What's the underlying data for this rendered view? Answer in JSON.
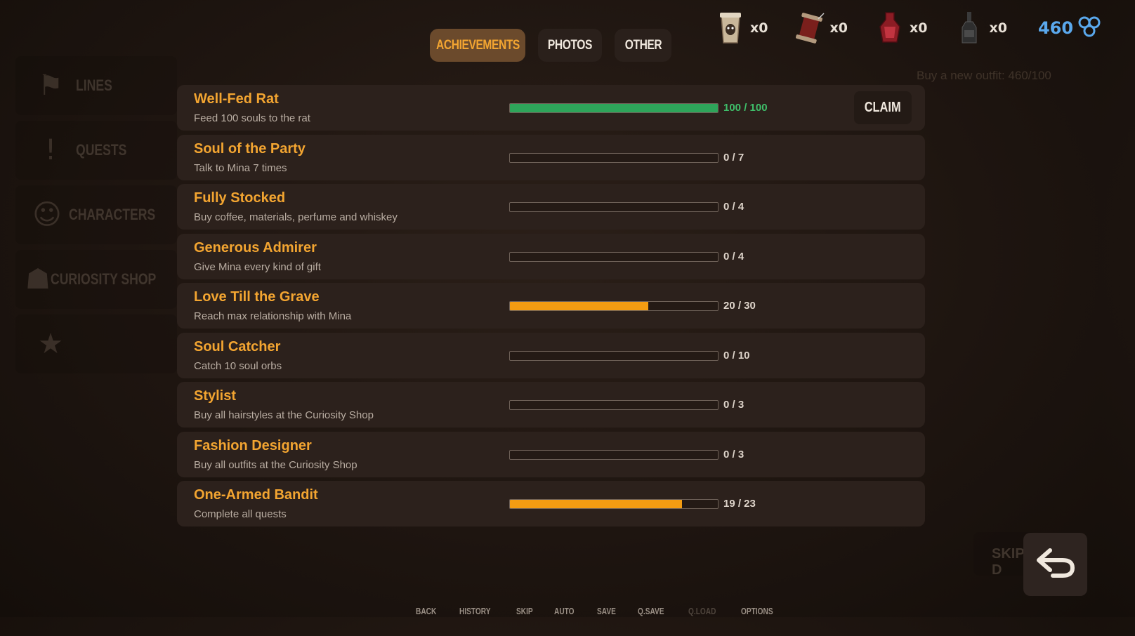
{
  "tabs": [
    {
      "label": "ACHIEVEMENTS",
      "active": true
    },
    {
      "label": "PHOTOS",
      "active": false
    },
    {
      "label": "OTHER",
      "active": false
    }
  ],
  "currency": {
    "items": [
      {
        "icon": "coffee-cup-icon",
        "count": "x0"
      },
      {
        "icon": "thread-spool-icon",
        "count": "x0"
      },
      {
        "icon": "perfume-bottle-icon",
        "count": "x0"
      },
      {
        "icon": "whiskey-bottle-icon",
        "count": "x0"
      }
    ],
    "souls": "460",
    "souls_icon": "soul-orb-icon",
    "souls_color": "#5aa8ec"
  },
  "background": {
    "menu": [
      "LINES",
      "QUESTS",
      "CHARACTERS",
      "CURIOSITY SHOP"
    ],
    "outfit_text": "Buy a new outfit:  460/100",
    "skip_text": "SKIP D"
  },
  "achievements": [
    {
      "title": "Well-Fed Rat",
      "desc": "Feed 100 souls to the rat",
      "current": 100,
      "total": 100,
      "progress_text": "100 / 100",
      "completed": true,
      "claim_label": "CLAIM"
    },
    {
      "title": "Soul of the Party",
      "desc": "Talk to Mina 7 times",
      "current": 0,
      "total": 7,
      "progress_text": "0 / 7",
      "completed": false
    },
    {
      "title": "Fully Stocked",
      "desc": "Buy coffee, materials, perfume and whiskey",
      "current": 0,
      "total": 4,
      "progress_text": "0 / 4",
      "completed": false
    },
    {
      "title": "Generous Admirer",
      "desc": "Give Mina every kind of gift",
      "current": 0,
      "total": 4,
      "progress_text": "0 / 4",
      "completed": false
    },
    {
      "title": "Love Till the Grave",
      "desc": "Reach max relationship with Mina",
      "current": 20,
      "total": 30,
      "progress_text": "20 / 30",
      "completed": false
    },
    {
      "title": "Soul Catcher",
      "desc": "Catch 10 soul orbs",
      "current": 0,
      "total": 10,
      "progress_text": "0 / 10",
      "completed": false
    },
    {
      "title": "Stylist",
      "desc": "Buy all hairstyles at the Curiosity Shop",
      "current": 0,
      "total": 3,
      "progress_text": "0 / 3",
      "completed": false
    },
    {
      "title": "Fashion Designer",
      "desc": "Buy all outfits at the Curiosity Shop",
      "current": 0,
      "total": 3,
      "progress_text": "0 / 3",
      "completed": false
    },
    {
      "title": "One-Armed Bandit",
      "desc": "Complete all quests",
      "current": 19,
      "total": 23,
      "progress_text": "19 / 23",
      "completed": false
    }
  ],
  "colors": {
    "accent": "#f3a531",
    "progress": "#f39c12",
    "complete": "#2ea55a"
  },
  "bottom_menu": [
    {
      "label": "BACK",
      "enabled": true
    },
    {
      "label": "HISTORY",
      "enabled": true
    },
    {
      "label": "SKIP",
      "enabled": true
    },
    {
      "label": "AUTO",
      "enabled": true
    },
    {
      "label": "SAVE",
      "enabled": true
    },
    {
      "label": "Q.SAVE",
      "enabled": true
    },
    {
      "label": "Q.LOAD",
      "enabled": false
    },
    {
      "label": "OPTIONS",
      "enabled": true
    }
  ],
  "back_button_icon": "return-arrow-icon"
}
